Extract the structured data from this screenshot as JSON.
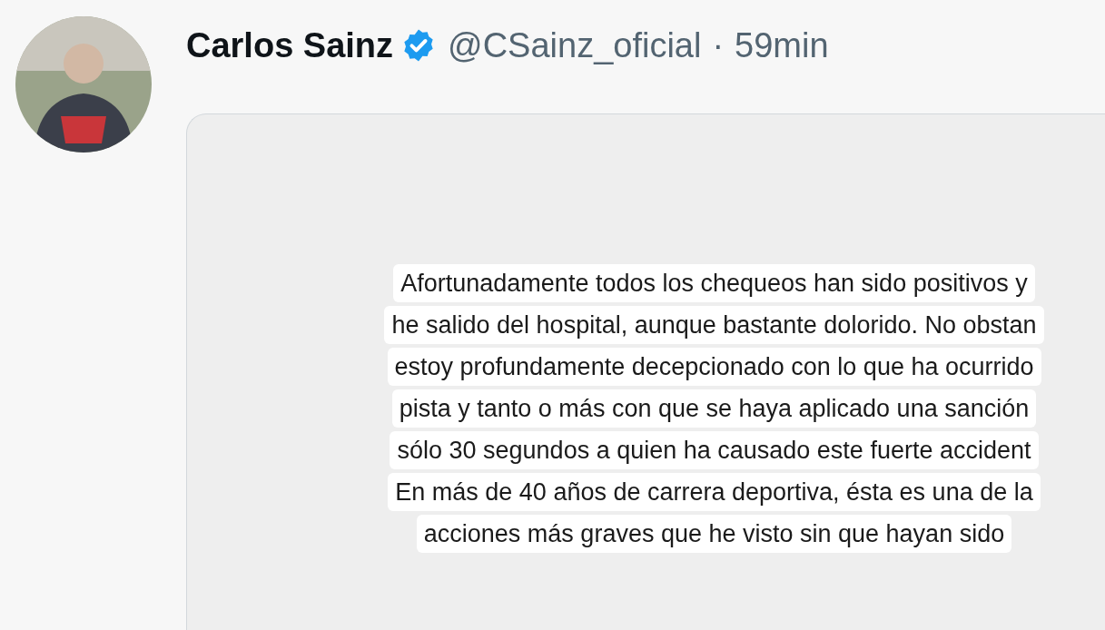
{
  "post": {
    "author": "Carlos Sainz",
    "verified": true,
    "handle": "@CSainz_oficial",
    "separator": "·",
    "time": "59min",
    "media": {
      "lines": [
        "Afortunadamente todos los chequeos han sido positivos y",
        "he salido del hospital, aunque bastante dolorido. No obstan",
        "estoy profundamente decepcionado con lo que ha ocurrido",
        "pista y tanto o más con que se haya aplicado una sanción",
        "sólo 30 segundos a quien ha causado este fuerte accident",
        "En más de 40 años de carrera deportiva, ésta es una de la",
        "acciones más graves que he visto sin que hayan sido"
      ]
    }
  }
}
